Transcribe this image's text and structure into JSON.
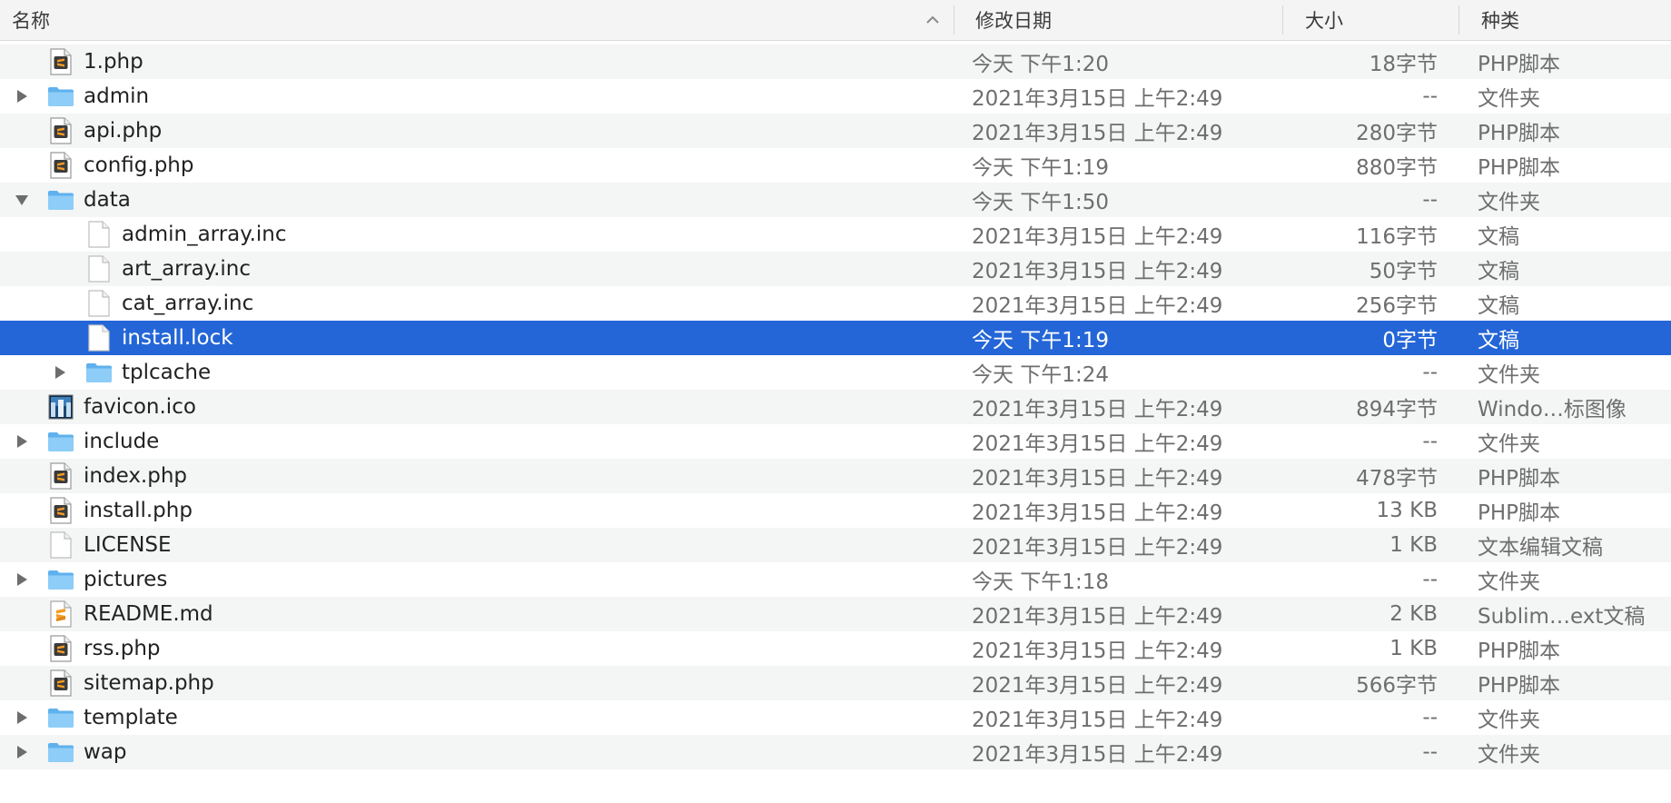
{
  "header": {
    "name": "名称",
    "date": "修改日期",
    "size": "大小",
    "kind": "种类"
  },
  "rows": [
    {
      "name": "1.php",
      "date": "今天 下午1:20",
      "size": "18字节",
      "kind": "PHP脚本",
      "icon": "php-file-icon",
      "depth": 0,
      "disclosure": "none"
    },
    {
      "name": "admin",
      "date": "2021年3月15日 上午2:49",
      "size": "--",
      "kind": "文件夹",
      "icon": "folder-icon",
      "depth": 0,
      "disclosure": "collapsed"
    },
    {
      "name": "api.php",
      "date": "2021年3月15日 上午2:49",
      "size": "280字节",
      "kind": "PHP脚本",
      "icon": "php-file-icon",
      "depth": 0,
      "disclosure": "none"
    },
    {
      "name": "config.php",
      "date": "今天 下午1:19",
      "size": "880字节",
      "kind": "PHP脚本",
      "icon": "php-file-icon",
      "depth": 0,
      "disclosure": "none"
    },
    {
      "name": "data",
      "date": "今天 下午1:50",
      "size": "--",
      "kind": "文件夹",
      "icon": "folder-icon",
      "depth": 0,
      "disclosure": "expanded"
    },
    {
      "name": "admin_array.inc",
      "date": "2021年3月15日 上午2:49",
      "size": "116字节",
      "kind": "文稿",
      "icon": "document-icon",
      "depth": 1,
      "disclosure": "none"
    },
    {
      "name": "art_array.inc",
      "date": "2021年3月15日 上午2:49",
      "size": "50字节",
      "kind": "文稿",
      "icon": "document-icon",
      "depth": 1,
      "disclosure": "none"
    },
    {
      "name": "cat_array.inc",
      "date": "2021年3月15日 上午2:49",
      "size": "256字节",
      "kind": "文稿",
      "icon": "document-icon",
      "depth": 1,
      "disclosure": "none"
    },
    {
      "name": "install.lock",
      "date": "今天 下午1:19",
      "size": "0字节",
      "kind": "文稿",
      "icon": "document-icon",
      "depth": 1,
      "disclosure": "none",
      "selected": true
    },
    {
      "name": "tplcache",
      "date": "今天 下午1:24",
      "size": "--",
      "kind": "文件夹",
      "icon": "folder-icon",
      "depth": 1,
      "disclosure": "collapsed"
    },
    {
      "name": "favicon.ico",
      "date": "2021年3月15日 上午2:49",
      "size": "894字节",
      "kind": "Windo…标图像",
      "icon": "ico-image-icon",
      "depth": 0,
      "disclosure": "none"
    },
    {
      "name": "include",
      "date": "2021年3月15日 上午2:49",
      "size": "--",
      "kind": "文件夹",
      "icon": "folder-icon",
      "depth": 0,
      "disclosure": "collapsed"
    },
    {
      "name": "index.php",
      "date": "2021年3月15日 上午2:49",
      "size": "478字节",
      "kind": "PHP脚本",
      "icon": "php-file-icon",
      "depth": 0,
      "disclosure": "none"
    },
    {
      "name": "install.php",
      "date": "2021年3月15日 上午2:49",
      "size": "13 KB",
      "kind": "PHP脚本",
      "icon": "php-file-icon",
      "depth": 0,
      "disclosure": "none"
    },
    {
      "name": "LICENSE",
      "date": "2021年3月15日 上午2:49",
      "size": "1 KB",
      "kind": "文本编辑文稿",
      "icon": "document-icon",
      "depth": 0,
      "disclosure": "none"
    },
    {
      "name": "pictures",
      "date": "今天 下午1:18",
      "size": "--",
      "kind": "文件夹",
      "icon": "folder-icon",
      "depth": 0,
      "disclosure": "collapsed"
    },
    {
      "name": "README.md",
      "date": "2021年3月15日 上午2:49",
      "size": "2 KB",
      "kind": "Sublim…ext文稿",
      "icon": "sublime-file-icon",
      "depth": 0,
      "disclosure": "none"
    },
    {
      "name": "rss.php",
      "date": "2021年3月15日 上午2:49",
      "size": "1 KB",
      "kind": "PHP脚本",
      "icon": "php-file-icon",
      "depth": 0,
      "disclosure": "none"
    },
    {
      "name": "sitemap.php",
      "date": "2021年3月15日 上午2:49",
      "size": "566字节",
      "kind": "PHP脚本",
      "icon": "php-file-icon",
      "depth": 0,
      "disclosure": "none"
    },
    {
      "name": "template",
      "date": "2021年3月15日 上午2:49",
      "size": "--",
      "kind": "文件夹",
      "icon": "folder-icon",
      "depth": 0,
      "disclosure": "collapsed"
    },
    {
      "name": "wap",
      "date": "2021年3月15日 上午2:49",
      "size": "--",
      "kind": "文件夹",
      "icon": "folder-icon",
      "depth": 0,
      "disclosure": "collapsed"
    }
  ],
  "colors": {
    "selection": "#2466d7",
    "folder": "#7ec3f4",
    "sublime_badge": "#f59a23"
  }
}
